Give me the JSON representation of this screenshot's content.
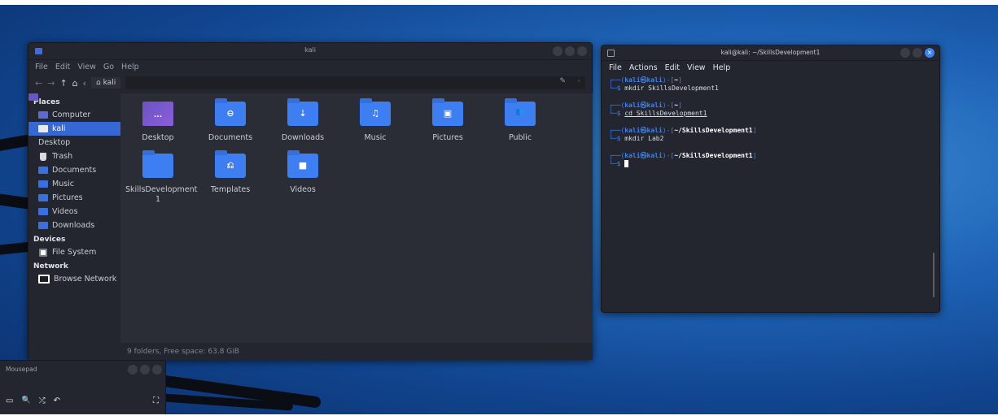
{
  "file_manager": {
    "window_title": "kali",
    "menu": [
      "File",
      "Edit",
      "View",
      "Go",
      "Help"
    ],
    "toolbar": {
      "back": "←",
      "forward": "→",
      "up": "↑",
      "home": "⌂",
      "prev_crumb": "‹",
      "breadcrumb": "⌂ kali",
      "edit": "✎",
      "next": "›"
    },
    "sidebar": {
      "places_header": "Places",
      "places": [
        {
          "label": "Computer",
          "icon": "computer-icon"
        },
        {
          "label": "kali",
          "icon": "home-icon",
          "active": true
        },
        {
          "label": "Desktop",
          "icon": "desktop-icon"
        },
        {
          "label": "Trash",
          "icon": "trash-icon"
        },
        {
          "label": "Documents",
          "icon": "folder-icon"
        },
        {
          "label": "Music",
          "icon": "folder-icon"
        },
        {
          "label": "Pictures",
          "icon": "folder-icon"
        },
        {
          "label": "Videos",
          "icon": "folder-icon"
        },
        {
          "label": "Downloads",
          "icon": "folder-icon"
        }
      ],
      "devices_header": "Devices",
      "devices": [
        {
          "label": "File System",
          "icon": "drive-icon"
        }
      ],
      "network_header": "Network",
      "network": [
        {
          "label": "Browse Network",
          "icon": "network-icon"
        }
      ]
    },
    "files": [
      {
        "label": "Desktop",
        "glyph": "...",
        "icon": "desktop-folder-icon"
      },
      {
        "label": "Documents",
        "glyph": "⊖",
        "icon": "documents-folder-icon"
      },
      {
        "label": "Downloads",
        "glyph": "⇣",
        "icon": "downloads-folder-icon"
      },
      {
        "label": "Music",
        "glyph": "♫",
        "icon": "music-folder-icon"
      },
      {
        "label": "Pictures",
        "glyph": "▣",
        "icon": "pictures-folder-icon"
      },
      {
        "label": "Public",
        "glyph": "👥",
        "icon": "public-folder-icon"
      },
      {
        "label": "SkillsDevelopment 1",
        "glyph": "",
        "icon": "folder-icon"
      },
      {
        "label": "Templates",
        "glyph": "⎌",
        "icon": "templates-folder-icon"
      },
      {
        "label": "Videos",
        "glyph": "■",
        "icon": "videos-folder-icon"
      }
    ],
    "status": "9 folders, Free space: 63.8 GiB"
  },
  "terminal": {
    "window_title": "kali@kali: ~/SkillsDevelopment1",
    "menu": [
      "File",
      "Actions",
      "Edit",
      "View",
      "Help"
    ],
    "close_glyph": "×",
    "blocks": [
      {
        "user": "kali㉿kali",
        "path": "~",
        "cmd": "mkdir SkillsDevelopment1"
      },
      {
        "user": "kali㉿kali",
        "path": "~",
        "cmd": "cd SkillsDevelopment1"
      },
      {
        "user": "kali㉿kali",
        "path": "~/SkillsDevelopment1",
        "cmd": "mkdir Lab2"
      },
      {
        "user": "kali㉿kali",
        "path": "~/SkillsDevelopment1",
        "cmd": ""
      }
    ]
  },
  "mousepad": {
    "window_title": "Mousepad",
    "toolbar": {
      "doc": "▭",
      "search": "🔍",
      "replace": "⤮",
      "undo": "↶",
      "fullscreen": "⛶"
    }
  },
  "colors": {
    "accent": "#3568d4",
    "folder_blue": "#3d7ef2",
    "prompt_blue": "#3b82f6",
    "window_bg": "#23262e"
  }
}
